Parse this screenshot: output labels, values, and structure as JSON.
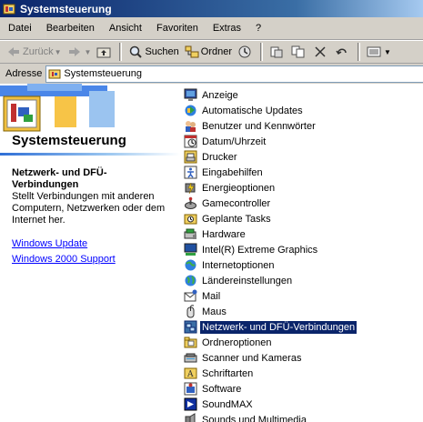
{
  "window": {
    "title": "Systemsteuerung"
  },
  "menu": [
    "Datei",
    "Bearbeiten",
    "Ansicht",
    "Favoriten",
    "Extras",
    "?"
  ],
  "toolbar": {
    "back": "Zurück",
    "search": "Suchen",
    "folders": "Ordner"
  },
  "address": {
    "label": "Adresse",
    "value": "Systemsteuerung"
  },
  "panel": {
    "title": "Systemsteuerung",
    "selected_name": "Netzwerk- und DFÜ-Verbindungen",
    "selected_description": "Stellt Verbindungen mit anderen Computern, Netzwerken oder dem Internet her.",
    "links": [
      "Windows Update",
      "Windows 2000 Support"
    ]
  },
  "items": [
    {
      "label": "Anzeige",
      "icon": "display-icon"
    },
    {
      "label": "Automatische Updates",
      "icon": "updates-icon"
    },
    {
      "label": "Benutzer und Kennwörter",
      "icon": "users-icon"
    },
    {
      "label": "Datum/Uhrzeit",
      "icon": "clock-icon"
    },
    {
      "label": "Drucker",
      "icon": "printer-icon"
    },
    {
      "label": "Eingabehilfen",
      "icon": "accessibility-icon"
    },
    {
      "label": "Energieoptionen",
      "icon": "power-icon"
    },
    {
      "label": "Gamecontroller",
      "icon": "gamepad-icon"
    },
    {
      "label": "Geplante Tasks",
      "icon": "tasks-folder-icon"
    },
    {
      "label": "Hardware",
      "icon": "hardware-icon"
    },
    {
      "label": "Intel(R) Extreme Graphics",
      "icon": "graphics-icon"
    },
    {
      "label": "Internetoptionen",
      "icon": "internet-icon"
    },
    {
      "label": "Ländereinstellungen",
      "icon": "globe-icon"
    },
    {
      "label": "Mail",
      "icon": "mail-icon"
    },
    {
      "label": "Maus",
      "icon": "mouse-icon"
    },
    {
      "label": "Netzwerk- und DFÜ-Verbindungen",
      "icon": "network-icon",
      "selected": true
    },
    {
      "label": "Ordneroptionen",
      "icon": "folder-options-icon"
    },
    {
      "label": "Scanner und Kameras",
      "icon": "scanner-icon"
    },
    {
      "label": "Schriftarten",
      "icon": "fonts-icon"
    },
    {
      "label": "Software",
      "icon": "software-icon"
    },
    {
      "label": "SoundMAX",
      "icon": "soundmax-icon"
    },
    {
      "label": "Sounds und Multimedia",
      "icon": "sounds-icon"
    }
  ],
  "colors": {
    "selection": "#0a246a",
    "chrome": "#d4d0c8",
    "link": "#0000ff"
  }
}
